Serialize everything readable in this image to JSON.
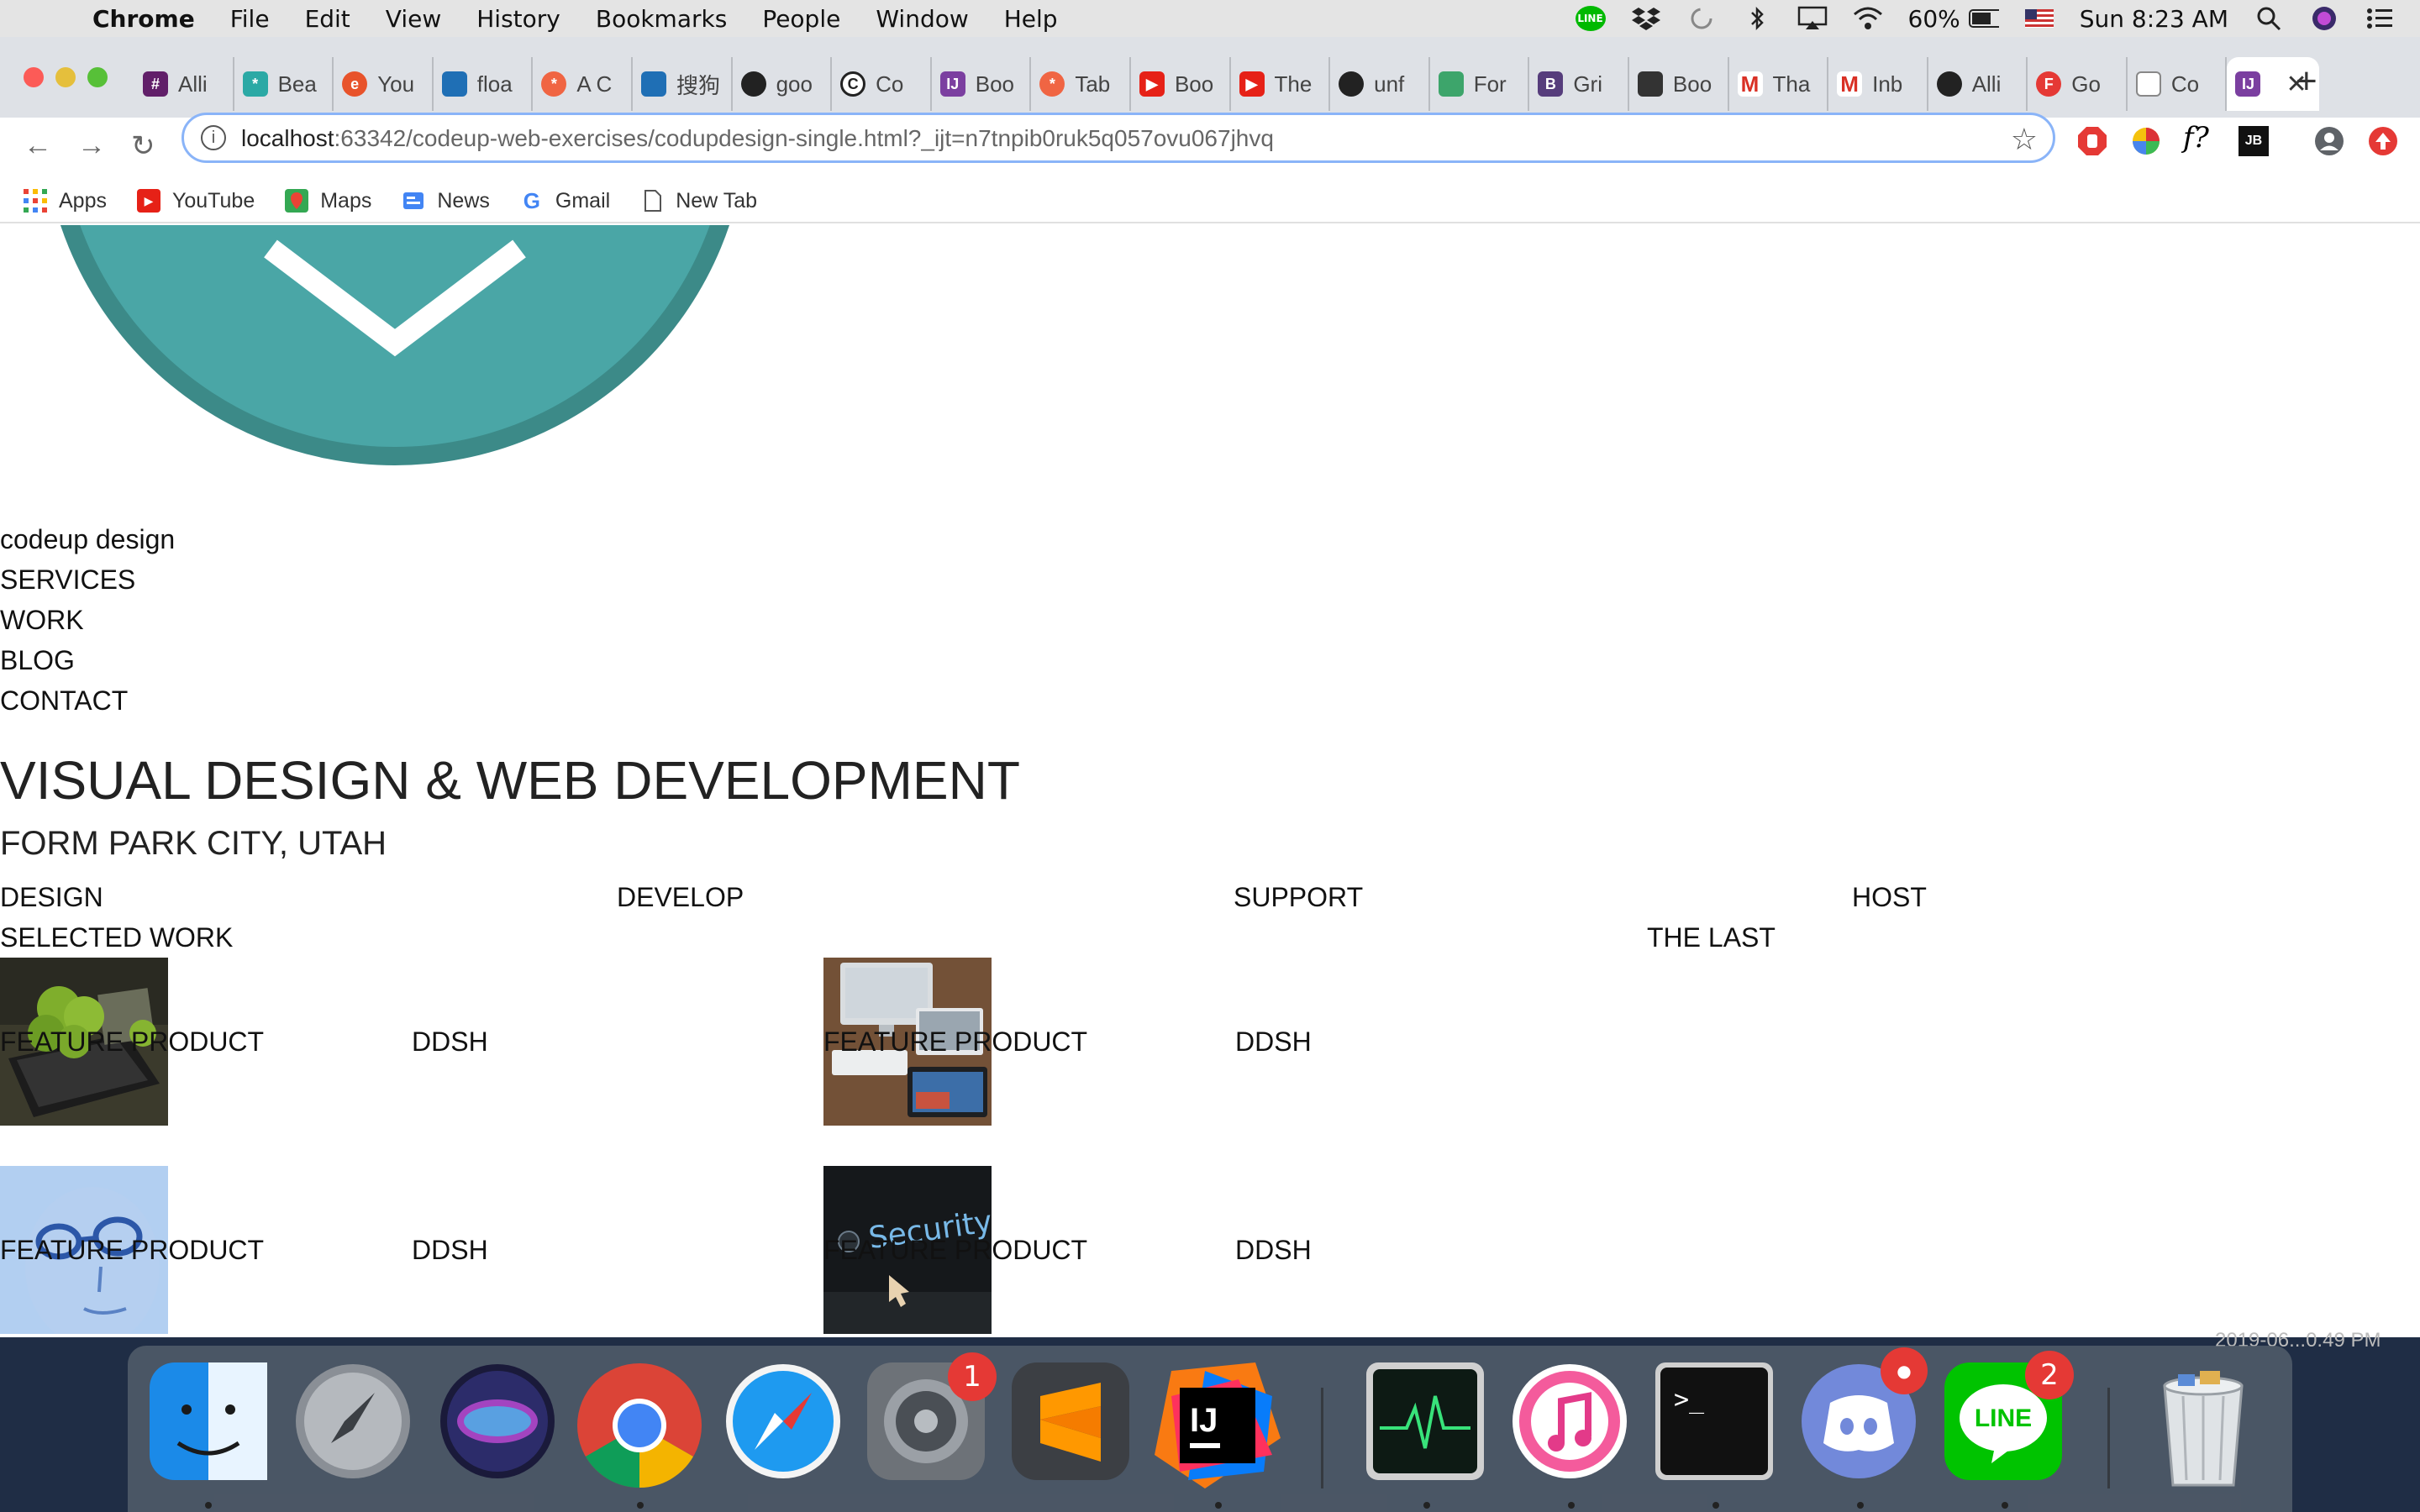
{
  "menubar": {
    "app": "Chrome",
    "items": [
      "File",
      "Edit",
      "View",
      "History",
      "Bookmarks",
      "People",
      "Window",
      "Help"
    ],
    "battery": "60%",
    "clock": "Sun 8:23 AM"
  },
  "tabs": [
    {
      "label": "Alli",
      "color": "#611f69"
    },
    {
      "label": "Bea",
      "color": "#2ba9a5"
    },
    {
      "label": "You",
      "color": "#e8532b"
    },
    {
      "label": "floa",
      "color": "#1f6fb5"
    },
    {
      "label": "A C",
      "color": "#f06543"
    },
    {
      "label": "搜狗",
      "color": "#1f6fb5"
    },
    {
      "label": "goo",
      "color": "#222222"
    },
    {
      "label": "Co",
      "color": "#222222"
    },
    {
      "label": "Boo",
      "color": "#7b3fa0"
    },
    {
      "label": "Tab",
      "color": "#f06543"
    },
    {
      "label": "Boo",
      "color": "#e62117"
    },
    {
      "label": "The",
      "color": "#e62117"
    },
    {
      "label": "unf",
      "color": "#222222"
    },
    {
      "label": "For",
      "color": "#3da56b"
    },
    {
      "label": "Gri",
      "color": "#563d7c"
    },
    {
      "label": "Boo",
      "color": "#333333"
    },
    {
      "label": "Tha",
      "color": "#d93025"
    },
    {
      "label": "Inb",
      "color": "#d93025"
    },
    {
      "label": "Alli",
      "color": "#222222"
    },
    {
      "label": "Go",
      "color": "#e53935"
    },
    {
      "label": "Co",
      "color": "#888888"
    }
  ],
  "address": {
    "host": "localhost",
    "rest": ":63342/codeup-web-exercises/codupdesign-single.html?_ijt=n7tnpib0ruk5q057ovu067jhvq"
  },
  "bookmarks": [
    "Apps",
    "YouTube",
    "Maps",
    "News",
    "Gmail",
    "New Tab"
  ],
  "page": {
    "brand": "codeup design",
    "nav": [
      "SERVICES",
      "WORK",
      "BLOG",
      "CONTACT"
    ],
    "headline": "VISUAL DESIGN & WEB DEVELOPMENT",
    "subheadline": "FORM PARK CITY, UTAH",
    "services": [
      "DESIGN",
      "DEVELOP",
      "SUPPORT",
      "HOST"
    ],
    "selected_work": "SELECTED WORK",
    "the_last": "THE LAST",
    "products": [
      {
        "title": "FEATURE PRODUCT",
        "tag": "DDSH"
      },
      {
        "title": "FEATURE PRODUCT",
        "tag": "DDSH"
      },
      {
        "title": "FEATURE PRODUCT",
        "tag": "DDSH"
      },
      {
        "title": "FEATURE PRODUCT",
        "tag": "DDSH"
      }
    ],
    "security_text": "Security"
  },
  "dock": {
    "settings_badge": "1",
    "line_badge": "2",
    "line_label": "LINE",
    "timestamp": "2019-06...0.49 PM"
  },
  "colors": {
    "logo_teal": "#4aa6a6",
    "logo_ring": "#3c8a88"
  }
}
